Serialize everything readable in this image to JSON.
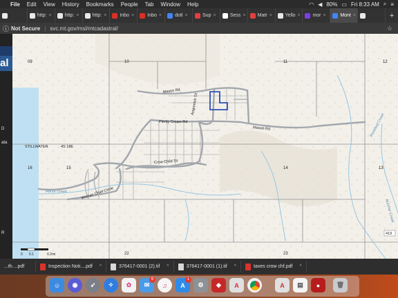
{
  "menubar": {
    "apple": "",
    "items": [
      "File",
      "Edit",
      "View",
      "History",
      "Bookmarks",
      "People",
      "Tab",
      "Window",
      "Help"
    ],
    "battery": "80%",
    "time": "Fri 8:33 AM"
  },
  "tabs": [
    {
      "label": "",
      "color": "#e9e9e9"
    },
    {
      "label": "http:",
      "color": "#e9e9e9"
    },
    {
      "label": "http:",
      "color": "#e9e9e9"
    },
    {
      "label": "http:",
      "color": "#e9e9e9"
    },
    {
      "label": "Inbo",
      "color": "#d93025"
    },
    {
      "label": "Inbo",
      "color": "#d93025"
    },
    {
      "label": "dotl",
      "color": "#4285f4"
    },
    {
      "label": "Sup",
      "color": "#e04040"
    },
    {
      "label": "Sess",
      "color": "#ffffff"
    },
    {
      "label": "Matr",
      "color": "#e04040"
    },
    {
      "label": "Yello",
      "color": "#e8e8e8"
    },
    {
      "label": "mor",
      "color": "#7b3fe4"
    },
    {
      "label": "Mont",
      "color": "#4285f4",
      "active": true
    },
    {
      "label": "",
      "color": "#e9e9e9"
    }
  ],
  "address": {
    "security": "Not Secure",
    "url": "svc.mt.gov/msl/mtcadastral/"
  },
  "sidebar": {
    "logo_text": "al",
    "side_letters": [
      "D",
      "ata",
      "R"
    ],
    "collapse_arrow": "▶"
  },
  "map": {
    "section_labels": [
      "09",
      "10",
      "11",
      "12",
      "16",
      "15",
      "14",
      "13",
      "22",
      "23"
    ],
    "township_label": "STILLWATER",
    "range_label": "4S 18E",
    "roads": [
      "Mason Rd",
      "Plenty Coups Rd",
      "Mason Rd",
      "Crow Child Trl",
      "Woman Chief Circle",
      "Arapooish Trl"
    ],
    "creeks": [
      "Horse Creek",
      "Rosebud Creek",
      "Butcher Creek"
    ],
    "route_badge": "419",
    "scale_labels": [
      "0",
      "0.1",
      "0.2mi"
    ],
    "colors": {
      "land": "#f3f0ea",
      "water": "#bfe0f2",
      "parcel_line": "#9a9a9a",
      "road": "#9aa0a6",
      "highlight": "#2b4fb5"
    }
  },
  "downloads": [
    {
      "name": "...th....pdf",
      "type": "pdf"
    },
    {
      "name": "Inspection Noti....pdf",
      "type": "pdf"
    },
    {
      "name": "376417-0001 (2).tif",
      "type": "tif"
    },
    {
      "name": "376417-0001 (1).tif",
      "type": "tif"
    },
    {
      "name": "taxes crow chf.pdf",
      "type": "pdf"
    }
  ],
  "dock": {
    "icons": [
      "finder-icon",
      "siri-icon",
      "launchpad-icon",
      "safari-icon",
      "photos-icon",
      "mail-icon",
      "itunes-icon",
      "app-store-icon",
      "system-preferences-icon",
      "shield-app-icon",
      "acrobat-icon",
      "chrome-icon",
      "acrobat-reader-icon",
      "preview-icon",
      "photo-booth-icon",
      "trash-icon"
    ],
    "mail_badge": "6",
    "appstore_badge": "1"
  }
}
